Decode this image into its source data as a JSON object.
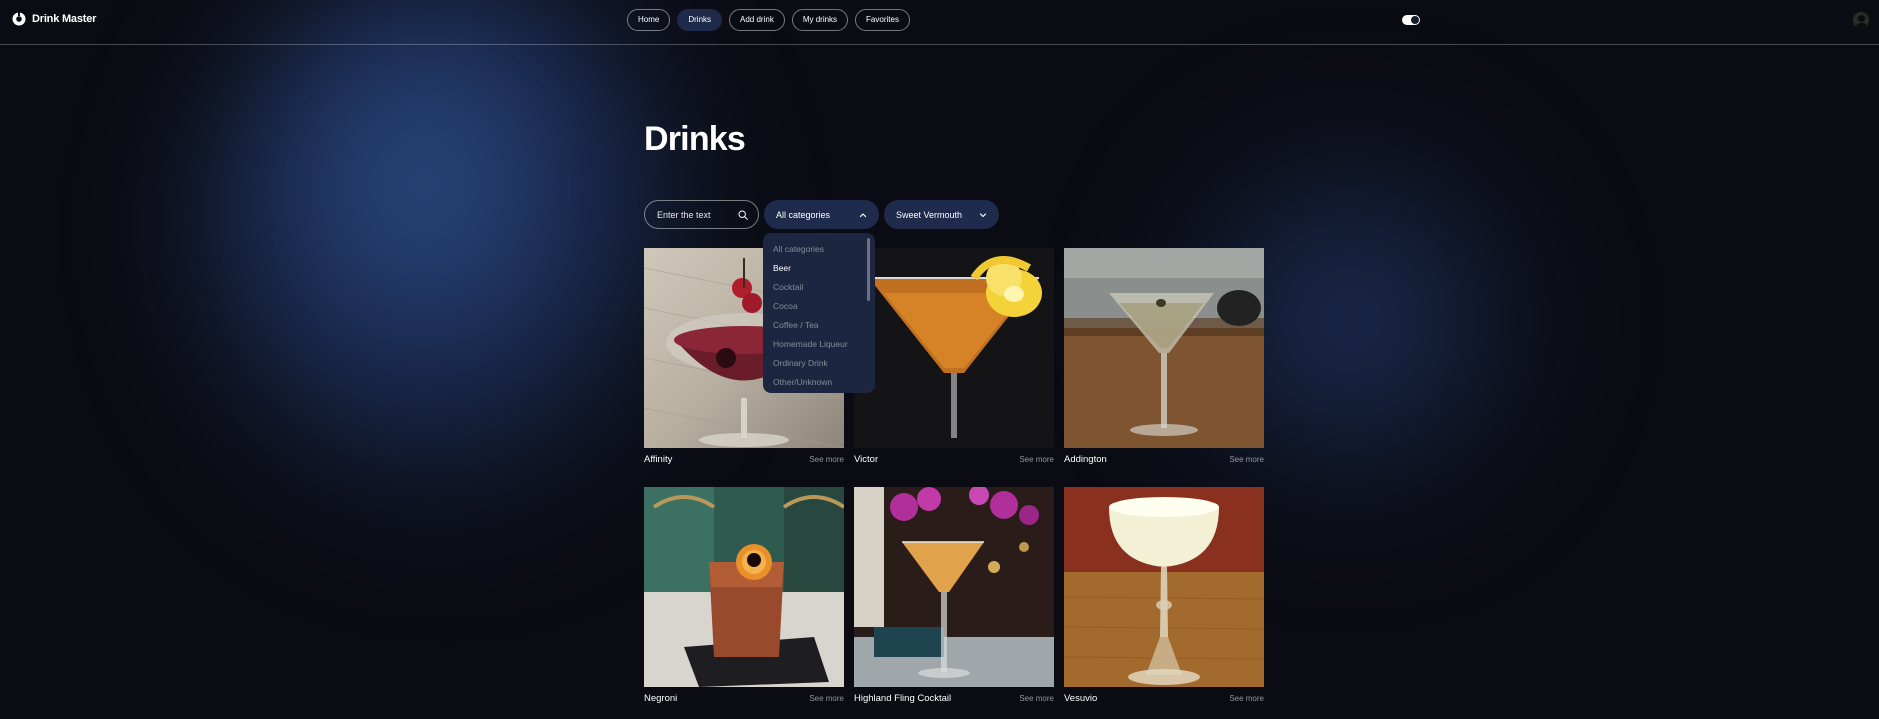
{
  "app": {
    "name": "Drink Master"
  },
  "nav": {
    "items": [
      {
        "label": "Home",
        "active": false
      },
      {
        "label": "Drinks",
        "active": true
      },
      {
        "label": "Add drink",
        "active": false
      },
      {
        "label": "My drinks",
        "active": false
      },
      {
        "label": "Favorites",
        "active": false
      }
    ]
  },
  "theme_toggle": {
    "on": true
  },
  "page": {
    "title": "Drinks"
  },
  "filters": {
    "search_placeholder": "Enter the text",
    "category": {
      "selected": "All categories",
      "open": true
    },
    "ingredient": {
      "selected": "Sweet Vermouth",
      "open": false
    }
  },
  "category_dropdown": {
    "options": [
      "All categories",
      "Beer",
      "Cocktail",
      "Cocoa",
      "Coffee / Tea",
      "Homemade Liqueur",
      "Ordinary Drink",
      "Other/Unknown"
    ],
    "highlighted": "Beer"
  },
  "drinks": [
    {
      "name": "Affinity",
      "see_more": "See more",
      "image": "red-martini-with-cherries"
    },
    {
      "name": "Victor",
      "see_more": "See more",
      "image": "orange-martini-with-lemon-twist"
    },
    {
      "name": "Addington",
      "see_more": "See more",
      "image": "martini-glass-on-table"
    },
    {
      "name": "Negroni",
      "see_more": "See more",
      "image": "rocks-glass-with-orange"
    },
    {
      "name": "Highland Fling Cocktail",
      "see_more": "See more",
      "image": "martini-at-bar-with-flowers"
    },
    {
      "name": "Vesuvio",
      "see_more": "See more",
      "image": "white-foamy-coupe"
    }
  ],
  "colors": {
    "background": "#0b0c13",
    "accent": "#1e2b4c",
    "glow": "#2f5291"
  }
}
